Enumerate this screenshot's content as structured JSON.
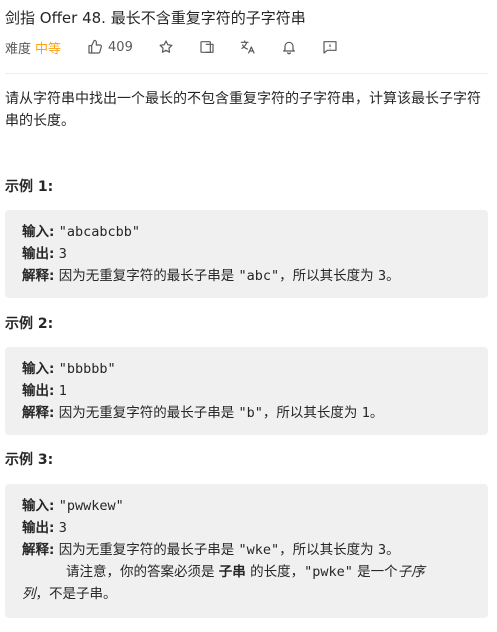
{
  "problem": {
    "title": "剑指 Offer 48. 最长不含重复字符的子字符串",
    "difficulty_label": "难度",
    "difficulty_value": "中等",
    "likes": "409",
    "difficulty_color": "#ffa116"
  },
  "toolbar_icons": [
    "thumbs-up-icon",
    "star-icon",
    "share-icon",
    "translate-icon",
    "bell-icon",
    "feedback-icon"
  ],
  "description": "请从字符串中找出一个最长的不包含重复字符的子字符串，计算该最长子字符串的长度。",
  "examples": [
    {
      "title": "示例 1:",
      "input_label": "输入:",
      "input": "\"abcabcbb\"",
      "output_label": "输出:",
      "output": "3",
      "explain_label": "解释:",
      "explain_pre": "因为无重复字符的最长子串是 ",
      "explain_code": "\"abc\"",
      "explain_post": "，所以其长度为 ",
      "explain_num": "3",
      "explain_end": "。"
    },
    {
      "title": "示例 2:",
      "input_label": "输入:",
      "input": "\"bbbbb\"",
      "output_label": "输出:",
      "output": "1",
      "explain_label": "解释:",
      "explain_pre": "因为无重复字符的最长子串是 ",
      "explain_code": "\"b\"",
      "explain_post": "，所以其长度为 ",
      "explain_num": "1",
      "explain_end": "。"
    },
    {
      "title": "示例 3:",
      "input_label": "输入:",
      "input": "\"pwwkew\"",
      "output_label": "输出:",
      "output": "3",
      "explain_label": "解释:",
      "explain_pre": "因为无重复字符的最长子串是 ",
      "explain_code": "\"wke\"",
      "explain_post": "，所以其长度为 ",
      "explain_num": "3",
      "explain_end": "。",
      "note_pre": "请注意，你的答案必须是 ",
      "note_bold": "子串",
      "note_mid": " 的长度，",
      "note_code": "\"pwke\"",
      "note_post": " 是一个",
      "note_italic_a": "子序",
      "note_italic_b": "列",
      "note_end": "，不是子串。"
    }
  ]
}
